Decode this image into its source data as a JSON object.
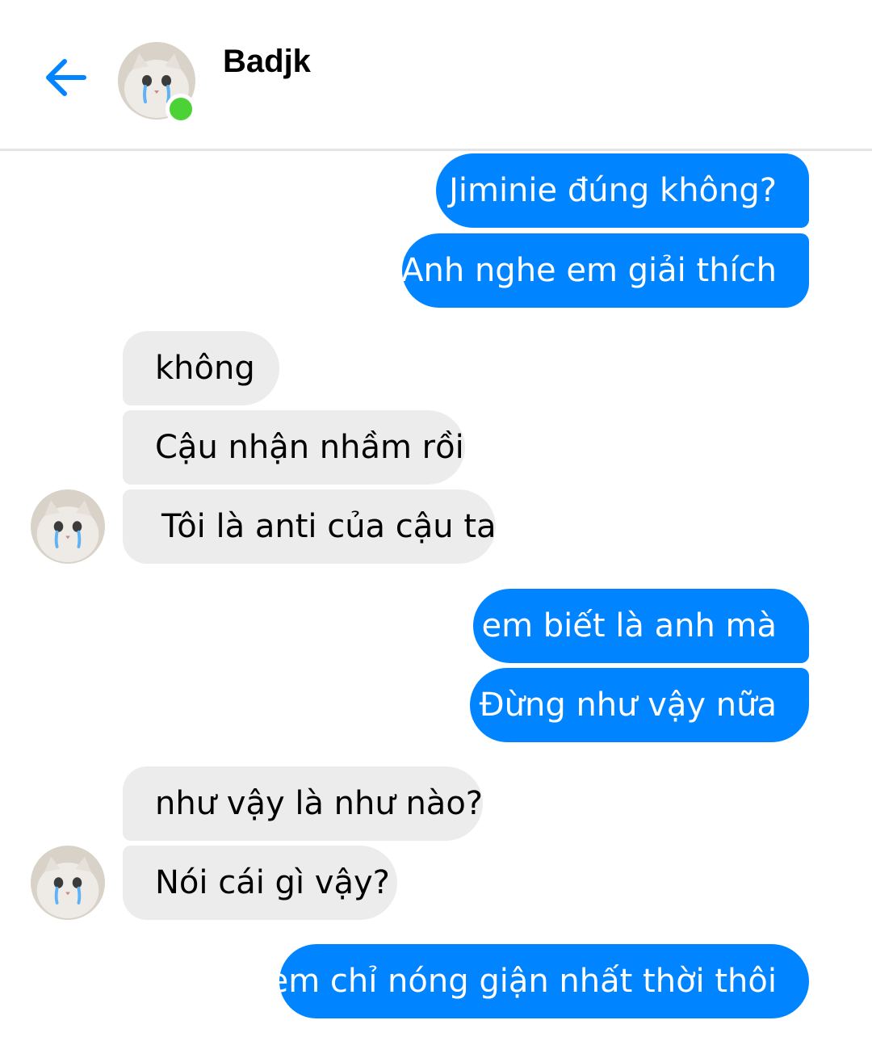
{
  "header": {
    "contact_name": "Badjk",
    "online": true
  },
  "messages": [
    {
      "sender": "me",
      "text": "Jiminie đúng không?"
    },
    {
      "sender": "me",
      "text": "Anh nghe em giải thích"
    },
    {
      "sender": "them",
      "text": "không"
    },
    {
      "sender": "them",
      "text": "Cậu nhận nhầm rồi"
    },
    {
      "sender": "them",
      "text": "Tôi là anti của cậu ta"
    },
    {
      "sender": "me",
      "text": "em biết là anh mà"
    },
    {
      "sender": "me",
      "text": "Đừng như vậy nữa"
    },
    {
      "sender": "them",
      "text": "như vậy là như nào?"
    },
    {
      "sender": "them",
      "text": "Nói cái gì vậy?"
    },
    {
      "sender": "me",
      "text": "em chỉ nóng giận nhất thời thôi"
    }
  ],
  "colors": {
    "outgoing_bubble": "#0084ff",
    "incoming_bubble": "#ececec",
    "online_dot": "#4cd137",
    "back_arrow": "#0084ff"
  },
  "icons": {
    "back": "arrow-left-icon",
    "avatar": "crying-cat-avatar"
  }
}
